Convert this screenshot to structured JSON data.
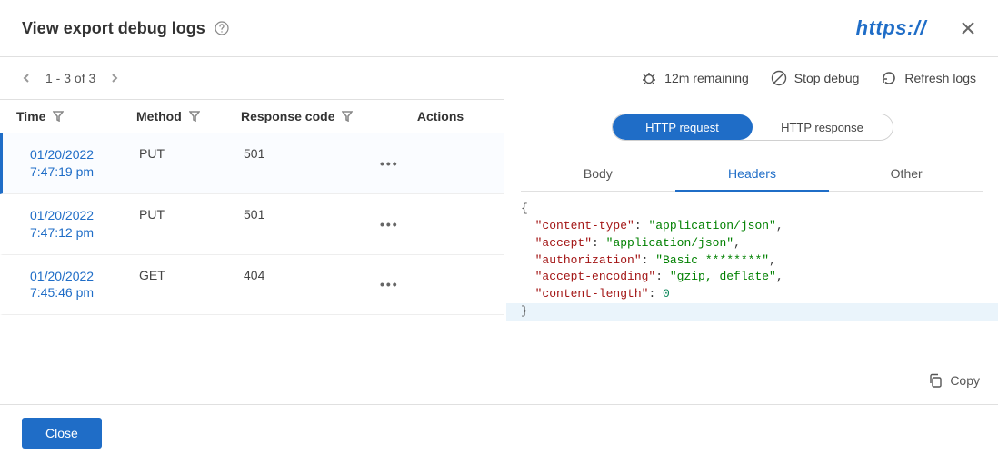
{
  "header": {
    "title": "View export debug logs",
    "https_label": "https://"
  },
  "toolbar": {
    "pager_text": "1 - 3 of 3",
    "remaining_label": "12m remaining",
    "stop_label": "Stop debug",
    "refresh_label": "Refresh logs"
  },
  "table": {
    "columns": {
      "time": "Time",
      "method": "Method",
      "code": "Response code",
      "actions": "Actions"
    },
    "rows": [
      {
        "date": "01/20/2022",
        "time": "7:47:19 pm",
        "method": "PUT",
        "code": "501"
      },
      {
        "date": "01/20/2022",
        "time": "7:47:12 pm",
        "method": "PUT",
        "code": "501"
      },
      {
        "date": "01/20/2022",
        "time": "7:45:46 pm",
        "method": "GET",
        "code": "404"
      }
    ]
  },
  "detail": {
    "segmented": {
      "request": "HTTP request",
      "response": "HTTP response",
      "active": "request"
    },
    "subtabs": {
      "body": "Body",
      "headers": "Headers",
      "other": "Other",
      "active": "headers"
    },
    "headers_json": {
      "content-type": "application/json",
      "accept": "application/json",
      "authorization": "Basic ********",
      "accept-encoding": "gzip, deflate",
      "content-length": 0
    },
    "copy_label": "Copy"
  },
  "footer": {
    "close_label": "Close"
  },
  "glyphs": {
    "ellipsis": "•••"
  }
}
